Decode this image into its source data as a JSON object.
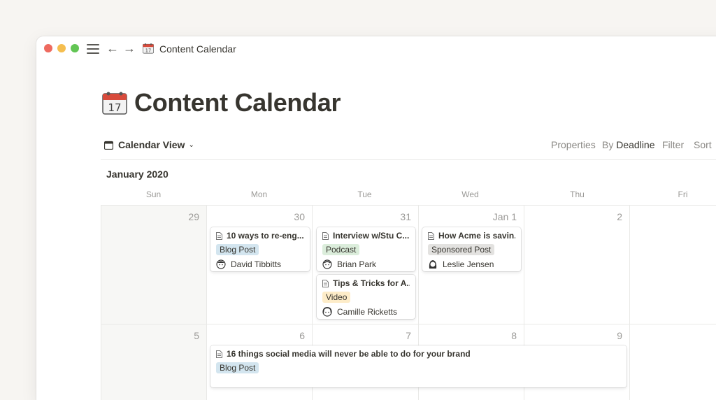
{
  "window": {
    "title": "Content Calendar",
    "title_icon": "calendar-emoji"
  },
  "page": {
    "title": "Content Calendar",
    "icon": "calendar-emoji"
  },
  "toolbar": {
    "view_label": "Calendar View",
    "properties_label": "Properties",
    "by_label": "By",
    "by_value": "Deadline",
    "filter_label": "Filter",
    "sort_label": "Sort"
  },
  "calendar": {
    "month": "January 2020",
    "weekdays": [
      "Sun",
      "Mon",
      "Tue",
      "Wed",
      "Thu",
      "Fri"
    ],
    "week1": [
      "29",
      "30",
      "31",
      "Jan 1",
      "2",
      ""
    ],
    "week2": [
      "5",
      "6",
      "7",
      "8",
      "9",
      ""
    ]
  },
  "events": [
    {
      "title": "10 ways to re-eng...",
      "tag": "Blog Post",
      "tag_color": "#d3e5ef",
      "person": "David Tibbitts"
    },
    {
      "title": "Interview w/Stu C...",
      "tag": "Podcast",
      "tag_color": "#dbeddb",
      "person": "Brian Park"
    },
    {
      "title": "Tips & Tricks for A...",
      "tag": "Video",
      "tag_color": "#fdecc8",
      "person": "Camille Ricketts"
    },
    {
      "title": "How Acme is savin...",
      "tag": "Sponsored Post",
      "tag_color": "#e3e2e0",
      "person": "Leslie Jensen"
    },
    {
      "title": "16 things social media will never be able to do for your brand",
      "tag": "Blog Post",
      "tag_color": "#d3e5ef"
    }
  ]
}
